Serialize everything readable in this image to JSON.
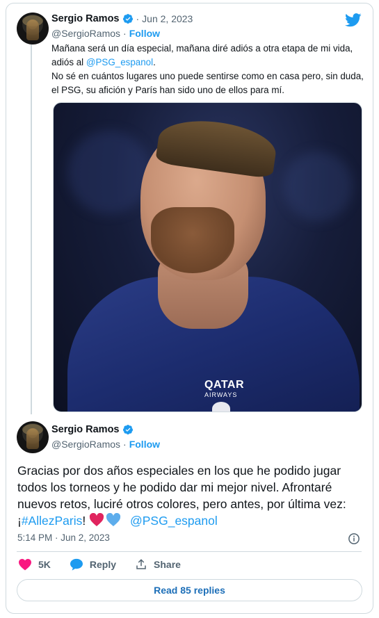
{
  "first_tweet": {
    "display_name": "Sergio Ramos",
    "separator": "·",
    "date": "Jun 2, 2023",
    "handle": "@SergioRamos",
    "handle_separator": "·",
    "follow_label": "Follow",
    "text_line1_a": "Mañana será un día especial, mañana diré adiós a otra etapa de mi vida, adiós al ",
    "text_line1_mention": "@PSG_espanol",
    "text_line1_b": ".",
    "text_line2": "No sé en cuántos lugares uno puede sentirse como en casa pero, sin duda, el PSG, su afición y París han sido uno de ellos para mí.",
    "photo": {
      "sponsor": "QATAR",
      "sponsor_sub": "AIRWAYS"
    }
  },
  "main_tweet": {
    "display_name": "Sergio Ramos",
    "handle": "@SergioRamos",
    "handle_separator": "·",
    "follow_label": "Follow",
    "text_a": "Gracias por dos años especiales en los que he podido jugar todos los torneos y he podido dar mi mejor nivel. Afrontaré nuevos retos, luciré otros colores, pero antes, por última vez: ¡",
    "hashtag": "#AllezParis",
    "text_b": "! ",
    "mention": "@PSG_espanol",
    "timestamp": "5:14 PM · Jun 2, 2023"
  },
  "actions": {
    "like_count": "5K",
    "reply_label": "Reply",
    "share_label": "Share"
  },
  "read_replies_label": "Read 85 replies",
  "colors": {
    "accent": "#1d9bf0",
    "like": "#f91880",
    "heart_red": "#e0245e",
    "heart_blue": "#5dadec"
  }
}
